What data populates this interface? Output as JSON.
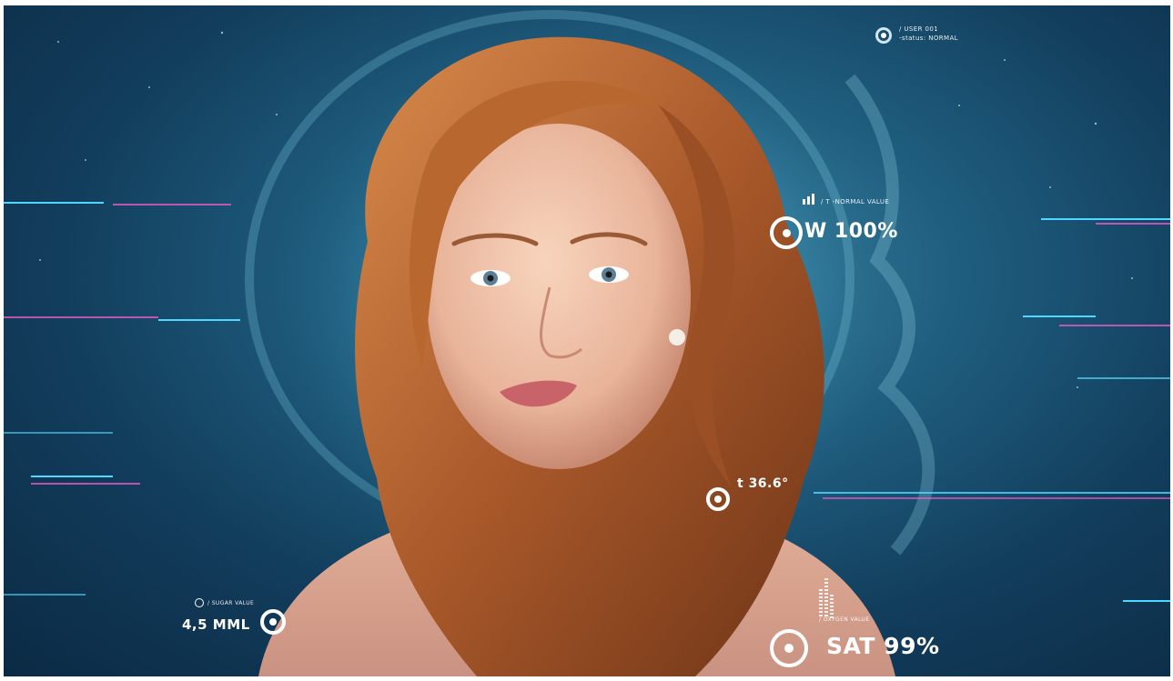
{
  "hud": {
    "user_id": "/ USER 001",
    "user_status": "-status: NORMAL",
    "weight_caption": "/ T -NORMAL VALUE",
    "weight_value": "W 100%",
    "temp_value": "t 36.6°",
    "sugar_caption": "/ SUGAR VALUE",
    "sugar_value": "4,5 MML",
    "oxygen_caption": "/ OXYGEN VALUE",
    "sat_value": "SAT 99%"
  },
  "colors": {
    "hud_text": "#ffffff",
    "glitch_cyan": "#4fd8ff",
    "glitch_magenta": "#ff5fd0",
    "hair": "#b5642e",
    "skin": "#f1c6ad"
  },
  "icons": [
    "target-icon",
    "signal-bars-icon",
    "level-bars-icon",
    "ring-icon"
  ]
}
